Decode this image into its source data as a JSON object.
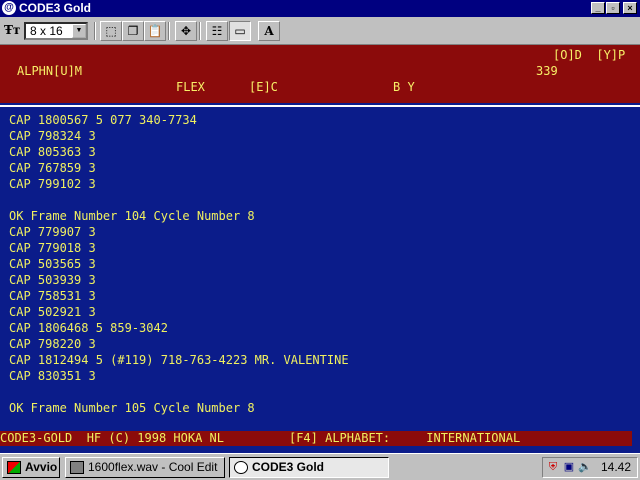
{
  "window": {
    "title": "CODE3 Gold"
  },
  "toolbar": {
    "font_size_value": "8 x 16"
  },
  "header": {
    "row1_right": "[O]D  [Y]P",
    "row2_left": "ALPHN[U]M",
    "row2_right": "339",
    "row3_flex": "FLEX",
    "row3_ec": "[E]C",
    "row3_by": "B Y"
  },
  "terminal": {
    "lines": [
      "CAP 1800567 5 077 340-7734",
      "CAP 798324 3",
      "CAP 805363 3",
      "CAP 767859 3",
      "CAP 799102 3",
      "",
      "OK Frame Number 104 Cycle Number 8",
      "CAP 779907 3",
      "CAP 779018 3",
      "CAP 503565 3",
      "CAP 503939 3",
      "CAP 758531 3",
      "CAP 502921 3",
      "CAP 1806468 5 859-3042",
      "CAP 798220 3",
      "CAP 1812494 5 (#119) 718-763-4223 MR. VALENTINE",
      "CAP 830351 3",
      "",
      "OK Frame Number 105 Cycle Number 8"
    ]
  },
  "status_bar": {
    "text": "CODE3-GOLD  HF (C) 1998 HOKA NL         [F4] ALPHABET:     INTERNATIONAL"
  },
  "taskbar": {
    "start_label": "Avvio",
    "tasks": [
      {
        "label": "1600flex.wav - Cool Edit"
      },
      {
        "label": "CODE3 Gold"
      }
    ],
    "clock": "14.42"
  },
  "colors": {
    "terminal_bg": "#0b1c8a",
    "header_bg": "#8b0b0b",
    "text": "#f0f060",
    "titlebar": "#000080"
  }
}
